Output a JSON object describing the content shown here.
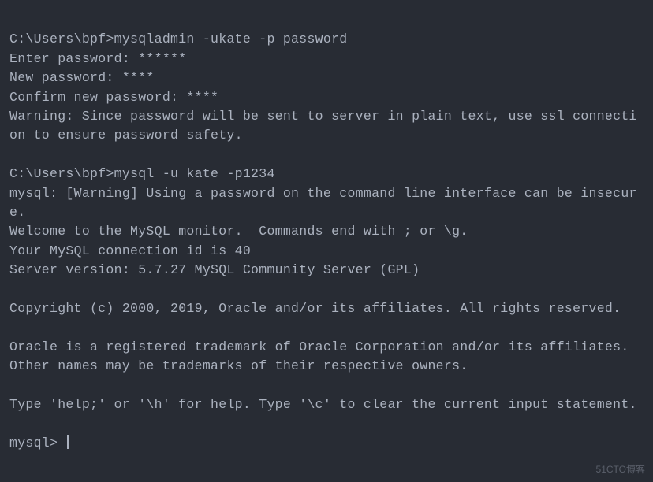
{
  "lines": {
    "l0": "C:\\Users\\bpf>mysqladmin -ukate -p password",
    "l1": "Enter password: ******",
    "l2": "New password: ****",
    "l3": "Confirm new password: ****",
    "l4": "Warning: Since password will be sent to server in plain text, use ssl connection to ensure password safety.",
    "l5": "",
    "l6": "C:\\Users\\bpf>mysql -u kate -p1234",
    "l7": "mysql: [Warning] Using a password on the command line interface can be insecure.",
    "l8": "Welcome to the MySQL monitor.  Commands end with ; or \\g.",
    "l9": "Your MySQL connection id is 40",
    "l10": "Server version: 5.7.27 MySQL Community Server (GPL)",
    "l11": "",
    "l12": "Copyright (c) 2000, 2019, Oracle and/or its affiliates. All rights reserved.",
    "l13": "",
    "l14": "Oracle is a registered trademark of Oracle Corporation and/or its affiliates. Other names may be trademarks of their respective owners.",
    "l15": "",
    "l16": "Type 'help;' or '\\h' for help. Type '\\c' to clear the current input statement.",
    "l17": "",
    "l18": "mysql> "
  },
  "watermark": "51CTO博客"
}
